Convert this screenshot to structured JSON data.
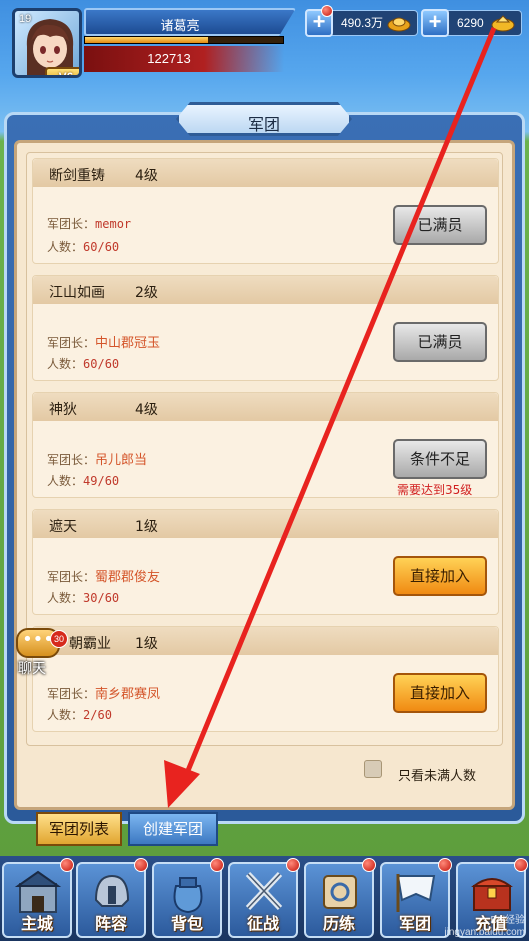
{
  "player": {
    "level": "19",
    "vip": "V6",
    "name": "诸葛亮",
    "power": "122713",
    "hp_fraction": 0.62
  },
  "resources": {
    "gold": "490.3万",
    "gems": "6290"
  },
  "panel": {
    "title": "军团"
  },
  "legions": [
    {
      "name": "断剑重铸",
      "level": "4级",
      "leader_label": "军团长：",
      "leader": "memor",
      "count_label": "人数：",
      "count": "60/60",
      "button": "已满员",
      "button_style": "gray",
      "note": ""
    },
    {
      "name": "江山如画",
      "level": "2级",
      "leader_label": "军团长：",
      "leader": "中山郡冠玉",
      "count_label": "人数：",
      "count": "60/60",
      "button": "已满员",
      "button_style": "gray",
      "note": ""
    },
    {
      "name": "神狄",
      "level": "4级",
      "leader_label": "军团长：",
      "leader": "吊儿郎当",
      "count_label": "人数：",
      "count": "49/60",
      "button": "条件不足",
      "button_style": "gray",
      "note": "需要达到35级"
    },
    {
      "name": "遮天",
      "level": "1级",
      "leader_label": "军团长：",
      "leader": "蜀郡郡俊友",
      "count_label": "人数：",
      "count": "30/60",
      "button": "直接加入",
      "button_style": "orange",
      "note": ""
    },
    {
      "name": "朝霸业",
      "level": "1级",
      "leader_label": "军团长：",
      "leader": "南乡郡赛凤",
      "count_label": "人数：",
      "count": "2/60",
      "button": "直接加入",
      "button_style": "orange",
      "note": ""
    }
  ],
  "filter": {
    "label": "只看未满人数",
    "checked": false
  },
  "tabs": {
    "list": "军团列表",
    "create": "创建军团"
  },
  "chat": {
    "label": "聊天",
    "badge": "30"
  },
  "nav": [
    {
      "label": "主城",
      "icon": "castle-icon"
    },
    {
      "label": "阵容",
      "icon": "helmet-icon"
    },
    {
      "label": "背包",
      "icon": "bag-icon"
    },
    {
      "label": "征战",
      "icon": "crossed-swords-icon"
    },
    {
      "label": "历练",
      "icon": "scroll-icon"
    },
    {
      "label": "军团",
      "icon": "banner-icon"
    },
    {
      "label": "充值",
      "icon": "chest-icon"
    }
  ],
  "watermark": "Bai经验\njingyan.baidu.com",
  "colors": {
    "annotation_arrow": "#e8231f",
    "join_button": "#f5a623",
    "full_button": "#b8b8b8"
  }
}
